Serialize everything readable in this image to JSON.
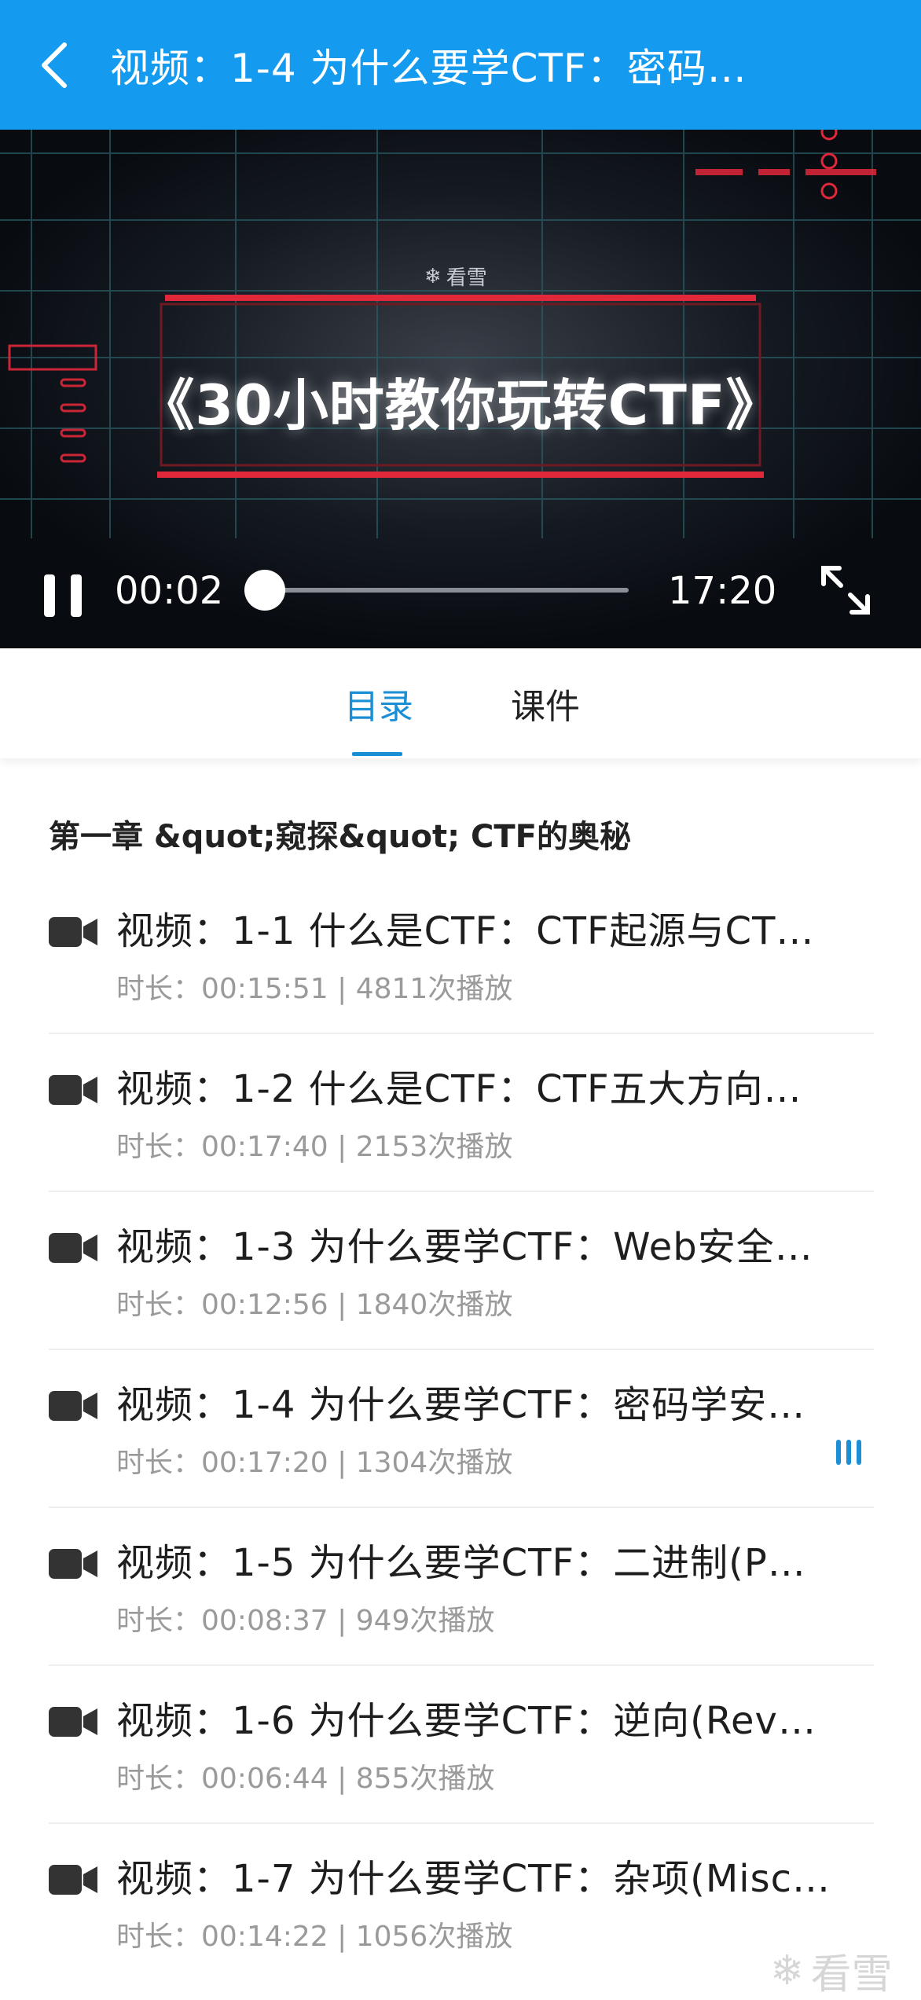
{
  "header": {
    "title": "视频：1-4 为什么要学CTF：密码…"
  },
  "player": {
    "watermark": "看雪",
    "course_title": "《30小时教你玩转CTF》",
    "current_time": "00:02",
    "total_time": "17:20",
    "progress_fraction": 0.002
  },
  "tabs": {
    "catalog": "目录",
    "courseware": "课件",
    "active": "目录"
  },
  "chapter": {
    "title": "第一章 &quot;窥探&quot; CTF的奥秘"
  },
  "videos": [
    {
      "title": "视频：1-1 什么是CTF：CTF起源与CT…",
      "meta": "时长：00:15:51 | 4811次播放",
      "playing": false
    },
    {
      "title": "视频：1-2 什么是CTF：CTF五大方向…",
      "meta": "时长：00:17:40 | 2153次播放",
      "playing": false
    },
    {
      "title": "视频：1-3 为什么要学CTF：Web安全…",
      "meta": "时长：00:12:56 | 1840次播放",
      "playing": false
    },
    {
      "title": "视频：1-4 为什么要学CTF：密码学安…",
      "meta": "时长：00:17:20 | 1304次播放",
      "playing": true
    },
    {
      "title": "视频：1-5 为什么要学CTF：二进制(P…",
      "meta": "时长：00:08:37 | 949次播放",
      "playing": false
    },
    {
      "title": "视频：1-6 为什么要学CTF：逆向(Rev…",
      "meta": "时长：00:06:44 | 855次播放",
      "playing": false
    },
    {
      "title": "视频：1-7 为什么要学CTF：杂项(Misc…",
      "meta": "时长：00:14:22 | 1056次播放",
      "playing": false
    }
  ],
  "footer": {
    "watermark": "看雪"
  },
  "colors": {
    "appbar": "#149bf0",
    "accent": "#1a8fd6",
    "player_bg": "#0c1018",
    "neon_red": "#e0283a",
    "grid_teal": "#2a5f66"
  }
}
